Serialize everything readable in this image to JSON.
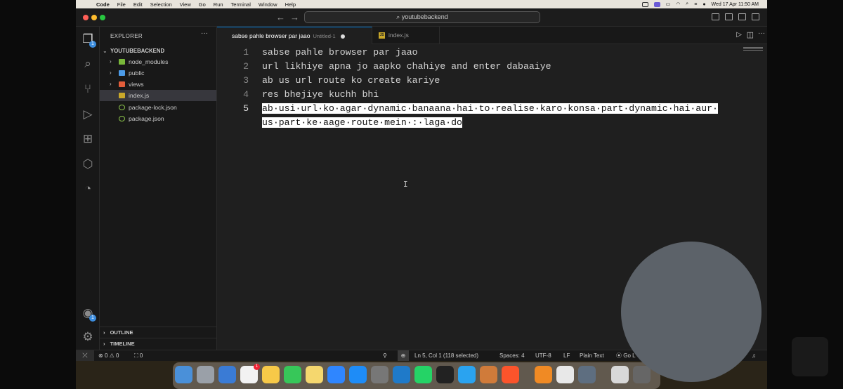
{
  "menubar": {
    "items": [
      "Code",
      "File",
      "Edit",
      "Selection",
      "View",
      "Go",
      "Run",
      "Terminal",
      "Window",
      "Help"
    ],
    "datetime": "Wed 17 Apr  11:50 AM"
  },
  "titlebar": {
    "search_text": "youtubebackend"
  },
  "sidebar": {
    "title": "EXPLORER",
    "more": "···",
    "folder": "YOUTUBEBACKEND",
    "items": [
      {
        "label": "node_modules",
        "type": "folder",
        "color": "#79b83a"
      },
      {
        "label": "public",
        "type": "folder",
        "color": "#4c9be8"
      },
      {
        "label": "views",
        "type": "folder",
        "color": "#e25d3a"
      },
      {
        "label": "index.js",
        "type": "file",
        "color": "#c9a82a",
        "selected": true
      },
      {
        "label": "package-lock.json",
        "type": "file",
        "color": "#8bc34a"
      },
      {
        "label": "package.json",
        "type": "file",
        "color": "#8bc34a"
      }
    ],
    "outline": "OUTLINE",
    "timeline": "TIMELINE"
  },
  "activity": {
    "explorer_badge": "1",
    "account_badge": "1"
  },
  "tabs": [
    {
      "label": "sabse pahle browser par jaao",
      "sub": "Untitled-1",
      "modified": true,
      "active": true
    },
    {
      "label": "index.js",
      "icon": "JS",
      "active": false
    }
  ],
  "editor": {
    "lines": [
      {
        "num": "1",
        "text": "sabse pahle browser par jaao"
      },
      {
        "num": "2",
        "text": "url likhiye apna jo aapko chahiye and enter dabaaiye"
      },
      {
        "num": "3",
        "text": "ab us url route ko create kariye"
      },
      {
        "num": "4",
        "text": "res bhejiye kuchh bhi"
      },
      {
        "num": "5",
        "text": "ab·usi·url·ko·agar·dynamic·banaana·hai·to·realise·karo·konsa·part·dynamic·hai·aur·",
        "selected": true
      },
      {
        "num": "",
        "text": "us·part·ke·aage·route·mein·:·laga·do",
        "selected": true
      }
    ]
  },
  "statusbar": {
    "errors": "0",
    "warnings": "0",
    "ports": "0",
    "position": "Ln 5, Col 1 (118 selected)",
    "spaces": "Spaces: 4",
    "encoding": "UTF-8",
    "eol": "LF",
    "language": "Plain Text",
    "golive": "Go L"
  },
  "dock_badge": "1"
}
